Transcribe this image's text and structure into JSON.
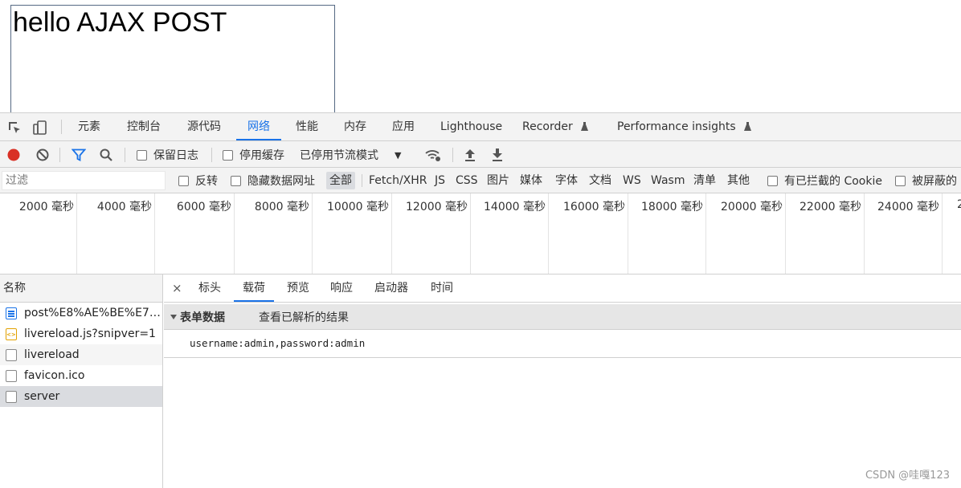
{
  "page": {
    "text": "hello AJAX POST"
  },
  "devtools": {
    "main_tabs": [
      "元素",
      "控制台",
      "源代码",
      "网络",
      "性能",
      "内存",
      "应用",
      "Lighthouse",
      "Recorder",
      "Performance insights"
    ],
    "active_tab": "网络",
    "toolbar": {
      "preserve_log": "保留日志",
      "disable_cache": "停用缓存",
      "throttling": "已停用节流模式"
    },
    "filter": {
      "placeholder": "过滤",
      "invert": "反转",
      "hide_data_urls": "隐藏数据网址",
      "types": [
        "全部",
        "Fetch/XHR",
        "JS",
        "CSS",
        "图片",
        "媒体",
        "字体",
        "文档",
        "WS",
        "Wasm",
        "清单",
        "其他"
      ],
      "active_type": "全部",
      "blocked_cookies": "有已拦截的 Cookie",
      "blocked_requests": "被屏蔽的"
    },
    "timeline_ticks": [
      "2000 毫秒",
      "4000 毫秒",
      "6000 毫秒",
      "8000 毫秒",
      "10000 毫秒",
      "12000 毫秒",
      "14000 毫秒",
      "16000 毫秒",
      "18000 毫秒",
      "20000 毫秒",
      "22000 毫秒",
      "24000 毫秒",
      "2"
    ],
    "requests": {
      "header": "名称",
      "items": [
        "post%E8%AE%BE%E7%...",
        "livereload.js?snipver=1",
        "livereload",
        "favicon.ico",
        "server"
      ],
      "selected": "server"
    },
    "detail": {
      "close": "×",
      "tabs": [
        "标头",
        "载荷",
        "预览",
        "响应",
        "启动器",
        "时间"
      ],
      "active_tab": "载荷",
      "section_title": "表单数据",
      "section_link": "查看已解析的结果",
      "form_data": "username:admin,password:admin"
    }
  },
  "watermark": "CSDN @哇嘎123",
  "colors": {
    "accent": "#1a73e8",
    "record": "#d93025"
  }
}
